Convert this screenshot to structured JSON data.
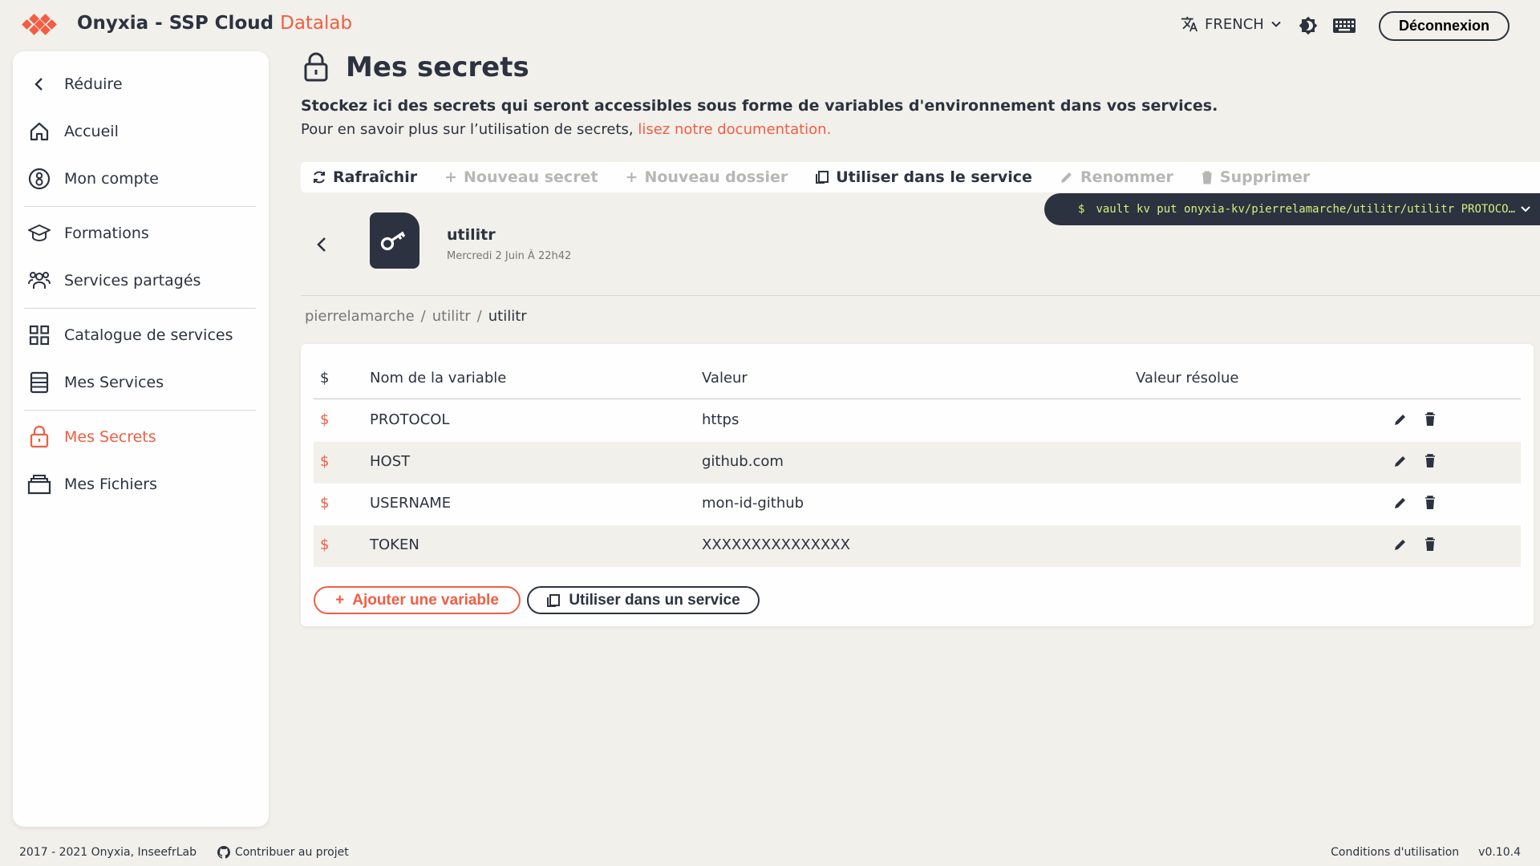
{
  "header": {
    "brand_main": "Onyxia - SSP Cloud",
    "brand_accent": "Datalab",
    "language": "FRENCH",
    "logout_label": "Déconnexion",
    "accent_color": "#f25d43"
  },
  "sidebar": {
    "collapse_label": "Réduire",
    "items": [
      {
        "label": "Accueil",
        "icon": "home-icon"
      },
      {
        "label": "Mon compte",
        "icon": "account-icon"
      },
      {
        "label": "Formations",
        "icon": "graduation-cap-icon"
      },
      {
        "label": "Services partagés",
        "icon": "group-icon"
      },
      {
        "label": "Catalogue de services",
        "icon": "grid-icon"
      },
      {
        "label": "Mes Services",
        "icon": "server-icon"
      },
      {
        "label": "Mes Secrets",
        "icon": "lock-icon",
        "active": true
      },
      {
        "label": "Mes Fichiers",
        "icon": "files-icon"
      }
    ]
  },
  "main": {
    "title": "Mes secrets",
    "subtitle": "Stockez ici des secrets qui seront accessibles sous forme de variables d'environnement dans vos services.",
    "help_text": "Pour en savoir plus sur l’utilisation de secrets,",
    "help_link": "lisez notre documentation.",
    "toolbar": {
      "refresh": "Rafraîchir",
      "new_secret": "Nouveau secret",
      "new_folder": "Nouveau dossier",
      "use_in_service": "Utiliser dans le service",
      "rename": "Renommer",
      "delete": "Supprimer"
    },
    "command": {
      "prompt": "$",
      "text": "vault kv put onyxia-kv/pierrelamarche/utilitr/utilitr PROTOCOL=https HOST=github.com USERNAME=mon-id-github TOKEN=XXXXXXXXXXXXXXX"
    },
    "secret": {
      "name": "utilitr",
      "date": "Mercredi 2 Juin À 22h42"
    },
    "breadcrumb": [
      "pierrelamarche",
      "/",
      "utilitr",
      "/",
      "utilitr"
    ],
    "table": {
      "headers": {
        "dollar": "$",
        "name": "Nom de la variable",
        "value": "Valeur",
        "resolved": "Valeur résolue"
      },
      "rows": [
        {
          "dollar": "$",
          "name": "PROTOCOL",
          "value": "https",
          "resolved": ""
        },
        {
          "dollar": "$",
          "name": "HOST",
          "value": "github.com",
          "resolved": ""
        },
        {
          "dollar": "$",
          "name": "USERNAME",
          "value": "mon-id-github",
          "resolved": ""
        },
        {
          "dollar": "$",
          "name": "TOKEN",
          "value": "XXXXXXXXXXXXXXX",
          "resolved": ""
        }
      ]
    },
    "add_variable_label": "Ajouter une variable",
    "use_service_label": "Utiliser dans un service"
  },
  "footer": {
    "copyright": "2017 - 2021 Onyxia, InseefrLab",
    "contribute": "Contribuer au projet",
    "terms": "Conditions d'utilisation",
    "version": "v0.10.4"
  }
}
